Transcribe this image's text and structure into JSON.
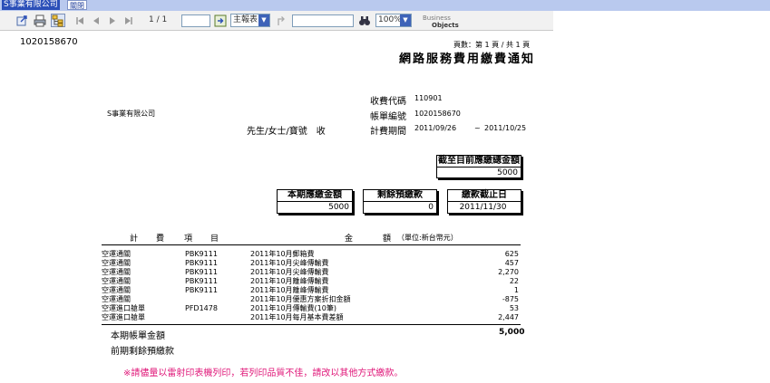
{
  "window": {
    "tab_title": "S事業有限公司",
    "close_label": "關閉"
  },
  "toolbar": {
    "page_status": "1 / 1",
    "page_input": "",
    "report_select": "主報表",
    "search_input": "",
    "zoom_select": "100%",
    "brand_small": "Business",
    "brand_big": "Objects"
  },
  "doc": {
    "account_no_corner": "1020158670",
    "page_info": "頁數：第 1 頁 / 共 1 頁",
    "title": "網路服務費用繳費通知",
    "company": "S事業有限公司",
    "salutation": "先生/女士/寶號　收",
    "fee_code_label": "收費代碼",
    "fee_code": "110901",
    "bill_no_label": "帳單編號",
    "bill_no": "1020158670",
    "period_label": "計費期間",
    "period_start": "2011/09/26",
    "period_sep": "~",
    "period_end": "2011/10/25",
    "box_total_due_label": "截至目前應繳總金額",
    "box_total_due": "5000",
    "box_current_label": "本期應繳金額",
    "box_current": "5000",
    "box_prepay_label": "剩餘預繳款",
    "box_prepay": "0",
    "box_deadline_label": "繳款截止日",
    "box_deadline": "2011/11/30",
    "items_header": {
      "c1": "計",
      "c2": "費",
      "c3": "項",
      "c4": "目",
      "amount": "金",
      "amount2": "額",
      "unit": "（單位:新台幣元）"
    },
    "items": [
      {
        "c1": "空運通關",
        "c2": "PBK9111",
        "c3": "2011年10月郵箱費",
        "amt": "625"
      },
      {
        "c1": "空運通關",
        "c2": "PBK9111",
        "c3": "2011年10月尖峰傳輸費",
        "amt": "457"
      },
      {
        "c1": "空運通關",
        "c2": "PBK9111",
        "c3": "2011年10月尖峰傳輸費",
        "amt": "2,270"
      },
      {
        "c1": "空運通關",
        "c2": "PBK9111",
        "c3": "2011年10月離峰傳輸費",
        "amt": "22"
      },
      {
        "c1": "空運通關",
        "c2": "PBK9111",
        "c3": "2011年10月離峰傳輸費",
        "amt": "1"
      },
      {
        "c1": "空運通關",
        "c2": "",
        "c3": "2011年10月優惠方案折扣金額",
        "amt": "-875"
      },
      {
        "c1": "空運進口艙單",
        "c2": "PFD1478",
        "c3": "2011年10月傳輸費(10筆)",
        "amt": "53"
      },
      {
        "c1": "空運進口艙單",
        "c2": "",
        "c3": "2011年10月每月基本費差額",
        "amt": "2,447"
      }
    ],
    "bill_total_label": "本期帳單金額",
    "bill_total": "5,000",
    "prev_prepay_label": "前期剩餘預繳款",
    "notice": "※請儘量以雷射印表機列印，若列印品質不佳，請改以其他方式繳款。"
  },
  "colors": {
    "tab_active": "#2b4fb8",
    "topbar": "#b9c9ee",
    "notice": "#e0197a"
  }
}
